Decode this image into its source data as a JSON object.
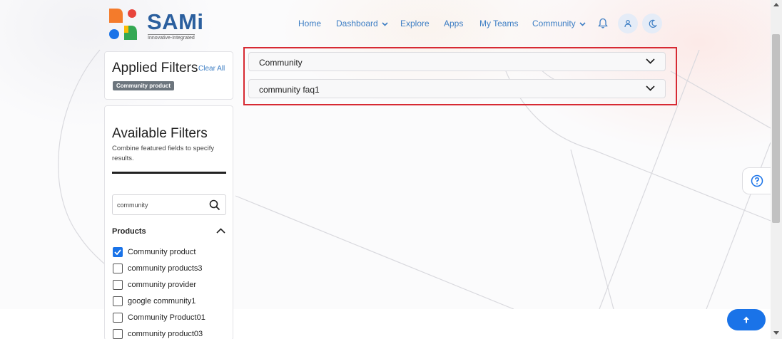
{
  "brand": {
    "name": "SAMi",
    "tagline": "Innovative-Integrated",
    "colors": {
      "primary": "#2b5f9e",
      "orange": "#f47b2b",
      "red": "#e8453c",
      "blue": "#1a73e8",
      "green": "#34a853",
      "yellow": "#fbbc04"
    }
  },
  "nav": {
    "home": "Home",
    "dashboard": "Dashboard",
    "explore": "Explore",
    "apps": "Apps",
    "my_teams": "My Teams",
    "community": "Community",
    "icons": [
      "bell-icon",
      "user-icon",
      "moon-icon"
    ]
  },
  "applied_filters": {
    "title": "Applied Filters",
    "clear_all": "Clear All",
    "chips": [
      "Community product"
    ]
  },
  "available_filters": {
    "title": "Available Filters",
    "description": "Combine featured fields to specify results.",
    "search": {
      "value": "community",
      "placeholder": ""
    },
    "section": {
      "title": "Products",
      "items": [
        {
          "label": "Community product",
          "checked": true
        },
        {
          "label": "community products3",
          "checked": false
        },
        {
          "label": "community provider",
          "checked": false
        },
        {
          "label": "google community1",
          "checked": false
        },
        {
          "label": "Community Product01",
          "checked": false
        },
        {
          "label": "community product03",
          "checked": false
        }
      ]
    }
  },
  "results": {
    "accordions": [
      {
        "label": "Community"
      },
      {
        "label": "community faq1"
      }
    ],
    "highlight_color": "#d72a33"
  },
  "floating": {
    "help_icon": "question-circle-icon",
    "scroll_top_icon": "arrow-up-icon",
    "accent": "#1a73e8"
  }
}
